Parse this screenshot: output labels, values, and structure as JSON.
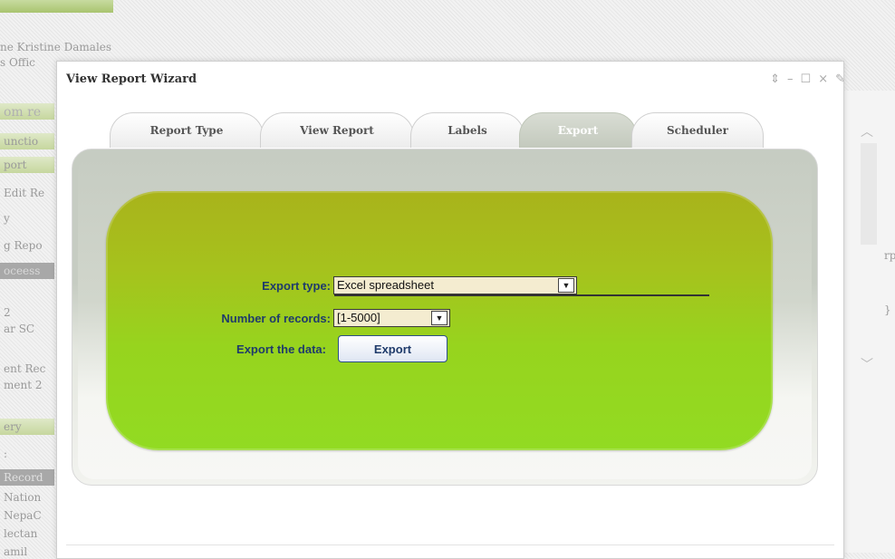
{
  "background_app": {
    "header_name": "ne Kristine Damales",
    "office_text": "s Offic",
    "items": [
      "om re",
      "unctio",
      "port",
      "Edit Re",
      "y",
      "g Repo",
      "oceess",
      "2",
      "ar SC",
      "ent Rec",
      "ment 2",
      "ery",
      ":",
      "Record",
      "Nation",
      "NepaC",
      "lectan",
      "amil"
    ],
    "right_items": [
      "rp",
      "}"
    ]
  },
  "modal": {
    "title": "View Report Wizard",
    "controls": {
      "pin": "⇕",
      "minimize": "–",
      "maximize": "☐",
      "close": "×",
      "extra": "✎"
    },
    "tabs": [
      {
        "label": "Report Type",
        "active": false
      },
      {
        "label": "View Report",
        "active": false
      },
      {
        "label": "Labels",
        "active": false
      },
      {
        "label": "Export",
        "active": true
      },
      {
        "label": "Scheduler",
        "active": false
      }
    ],
    "form": {
      "export_type_label": "Export type:",
      "export_type_value": "Excel spreadsheet",
      "records_label": "Number of records:",
      "records_value": "[1-5000]",
      "export_data_label": "Export the data:",
      "export_button": "Export"
    }
  },
  "colors": {
    "green_top": "#a9b31b",
    "green_bottom": "#92db22",
    "label_blue": "#1f3b6b",
    "select_bg": "#f4ecd0",
    "active_tab": "#c3c9bd"
  },
  "icons": {
    "dropdown_arrow": "chevron-down-icon",
    "scroll_up": "chevron-up-icon",
    "scroll_down": "chevron-down-icon"
  }
}
